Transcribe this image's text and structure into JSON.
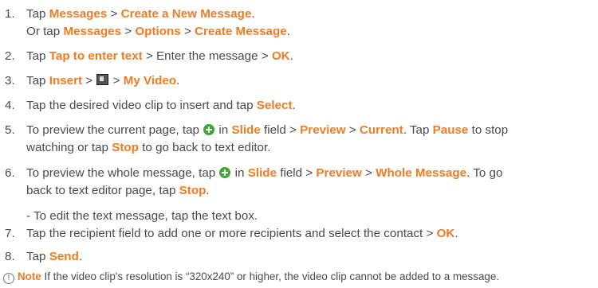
{
  "steps": [
    {
      "num": "1.",
      "line1": {
        "t1": "Tap ",
        "h1": "Messages",
        "t2": " > ",
        "h2": "Create a New Message",
        "t3": "."
      },
      "line2": {
        "t1": "Or tap ",
        "h1": "Messages",
        "t2": " > ",
        "h2": "Options",
        "t3": " > ",
        "h3": "Create Message",
        "t4": "."
      }
    },
    {
      "num": "2.",
      "t1": "Tap ",
      "h1": "Tap to enter text",
      "t2": " > Enter the message > ",
      "h2": "OK",
      "t3": "."
    },
    {
      "num": "3.",
      "t1": "Tap ",
      "h1": "Insert",
      "t2": " > ",
      "icon": "video-icon",
      "t3": " > ",
      "h2": "My Video",
      "t4": "."
    },
    {
      "num": "4.",
      "t1": "Tap the desired video clip to insert and tap ",
      "h1": "Select",
      "t2": "."
    },
    {
      "num": "5.",
      "line1": {
        "t1": "To preview the current page, tap ",
        "icon": "plus-icon",
        "t2": " in ",
        "h1": "Slide",
        "t3": " field > ",
        "h2": "Preview",
        "t4": " > ",
        "h3": "Current",
        "t5": ". Tap ",
        "h4": "Pause",
        "t6": " to stop"
      },
      "line2": {
        "t1": "watching or tap ",
        "h1": "Stop",
        "t2": " to go back to text editor."
      }
    },
    {
      "num": "6.",
      "line1": {
        "t1": "To preview the whole message, tap ",
        "icon": "plus-icon",
        "t2": " in ",
        "h1": "Slide",
        "t3": " field > ",
        "h2": "Preview",
        "t4": " > ",
        "h3": "Whole Message",
        "t5": ". To go"
      },
      "line2": {
        "t1": "back to text editor page, tap ",
        "h1": "Stop",
        "t2": "."
      },
      "subnote": "- To edit the text message, tap the text box."
    },
    {
      "num": "7.",
      "t1": "Tap the recipient field to add one or more recipients and select the contact > ",
      "h1": "OK",
      "t2": "."
    },
    {
      "num": "8.",
      "t1": "Tap ",
      "h1": "Send",
      "t2": "."
    }
  ],
  "note": {
    "icon": "info-icon",
    "icon_glyph": "!",
    "label": "Note",
    "text": " If the video clip's resolution is “320x240” or higher, the video clip cannot be added to a message."
  },
  "colors": {
    "highlight": "#f07b22",
    "text": "#4a4a4a",
    "plus_icon": "#3aa935"
  }
}
